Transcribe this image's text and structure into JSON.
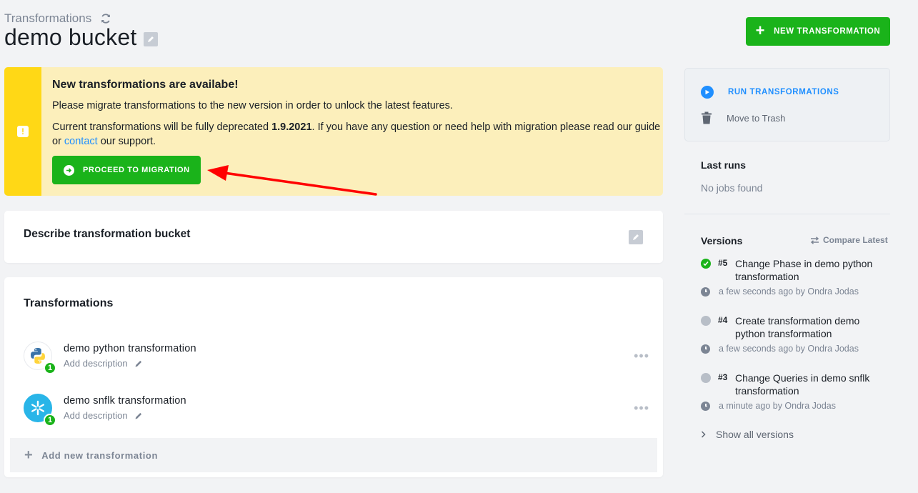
{
  "header": {
    "breadcrumb": "Transformations",
    "title": "demo bucket",
    "new_button_label": "NEW TRANSFORMATION"
  },
  "alert": {
    "title": "New transformations are availabe!",
    "line1": "Please migrate transformations to the new version in order to unlock the latest features.",
    "line2_prefix": "Current transformations will be fully deprecated ",
    "line2_date": "1.9.2021",
    "line2_suffix": ". If you have any question or need help with migration please read our guide or ",
    "line2_link": "contact",
    "line2_end": " our support.",
    "button_label": "PROCEED TO MIGRATION"
  },
  "description_card": {
    "title": "Describe transformation bucket"
  },
  "transformations": {
    "title": "Transformations",
    "items": [
      {
        "name": "demo python transformation",
        "description": "Add description",
        "badge": "1",
        "icon": "python-icon"
      },
      {
        "name": "demo snflk transformation",
        "description": "Add description",
        "badge": "1",
        "icon": "snowflake-icon"
      }
    ],
    "add_label": "Add new transformation"
  },
  "sidebar": {
    "run_label": "RUN TRANSFORMATIONS",
    "trash_label": "Move to Trash",
    "last_runs_title": "Last runs",
    "last_runs_empty": "No jobs found",
    "versions_title": "Versions",
    "compare_label": "Compare Latest",
    "versions": [
      {
        "num": "#5",
        "text": "Change Phase in demo python transformation",
        "meta": "a few seconds ago by Ondra Jodas",
        "status": "current"
      },
      {
        "num": "#4",
        "text": "Create transformation demo python transformation",
        "meta": "a few seconds ago by Ondra Jodas",
        "status": "previous"
      },
      {
        "num": "#3",
        "text": "Change Queries in demo snflk transformation",
        "meta": "a minute ago by Ondra Jodas",
        "status": "previous"
      }
    ],
    "show_all_label": "Show all versions"
  },
  "colors": {
    "primary_green": "#1ab31a",
    "link_blue": "#1f8fff",
    "alert_bg": "#fcefbb",
    "alert_strip": "#ffd816",
    "annotation_red": "#ff0000"
  }
}
